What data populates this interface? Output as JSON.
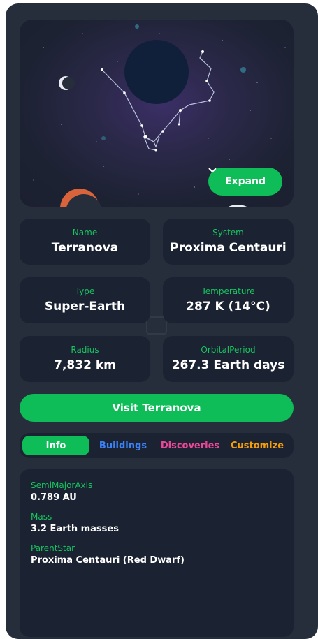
{
  "hero": {
    "expand_label": "Expand",
    "colors": {
      "accent": "#0fbd58",
      "panel": "#262d3b",
      "card": "#1b2232"
    }
  },
  "stats": [
    {
      "label": "Name",
      "value": "Terranova"
    },
    {
      "label": "System",
      "value": "Proxima Centauri"
    },
    {
      "label": "Type",
      "value": "Super-Earth"
    },
    {
      "label": "Temperature",
      "value": "287 K (14°C)"
    },
    {
      "label": "Radius",
      "value": "7,832 km"
    },
    {
      "label": "OrbitalPeriod",
      "value": "267.3 Earth days"
    }
  ],
  "visit_button": "Visit Terranova",
  "tabs": [
    {
      "label": "Info",
      "color": "#ffffff",
      "active": true
    },
    {
      "label": "Buildings",
      "color": "#3b82f6",
      "active": false
    },
    {
      "label": "Discoveries",
      "color": "#ec4899",
      "active": false
    },
    {
      "label": "Customize",
      "color": "#f59e0b",
      "active": false
    }
  ],
  "info": [
    {
      "key": "SemiMajorAxis",
      "value": "0.789 AU"
    },
    {
      "key": "Mass",
      "value": "3.2 Earth masses"
    },
    {
      "key": "ParentStar",
      "value": "Proxima Centauri (Red Dwarf)"
    }
  ]
}
